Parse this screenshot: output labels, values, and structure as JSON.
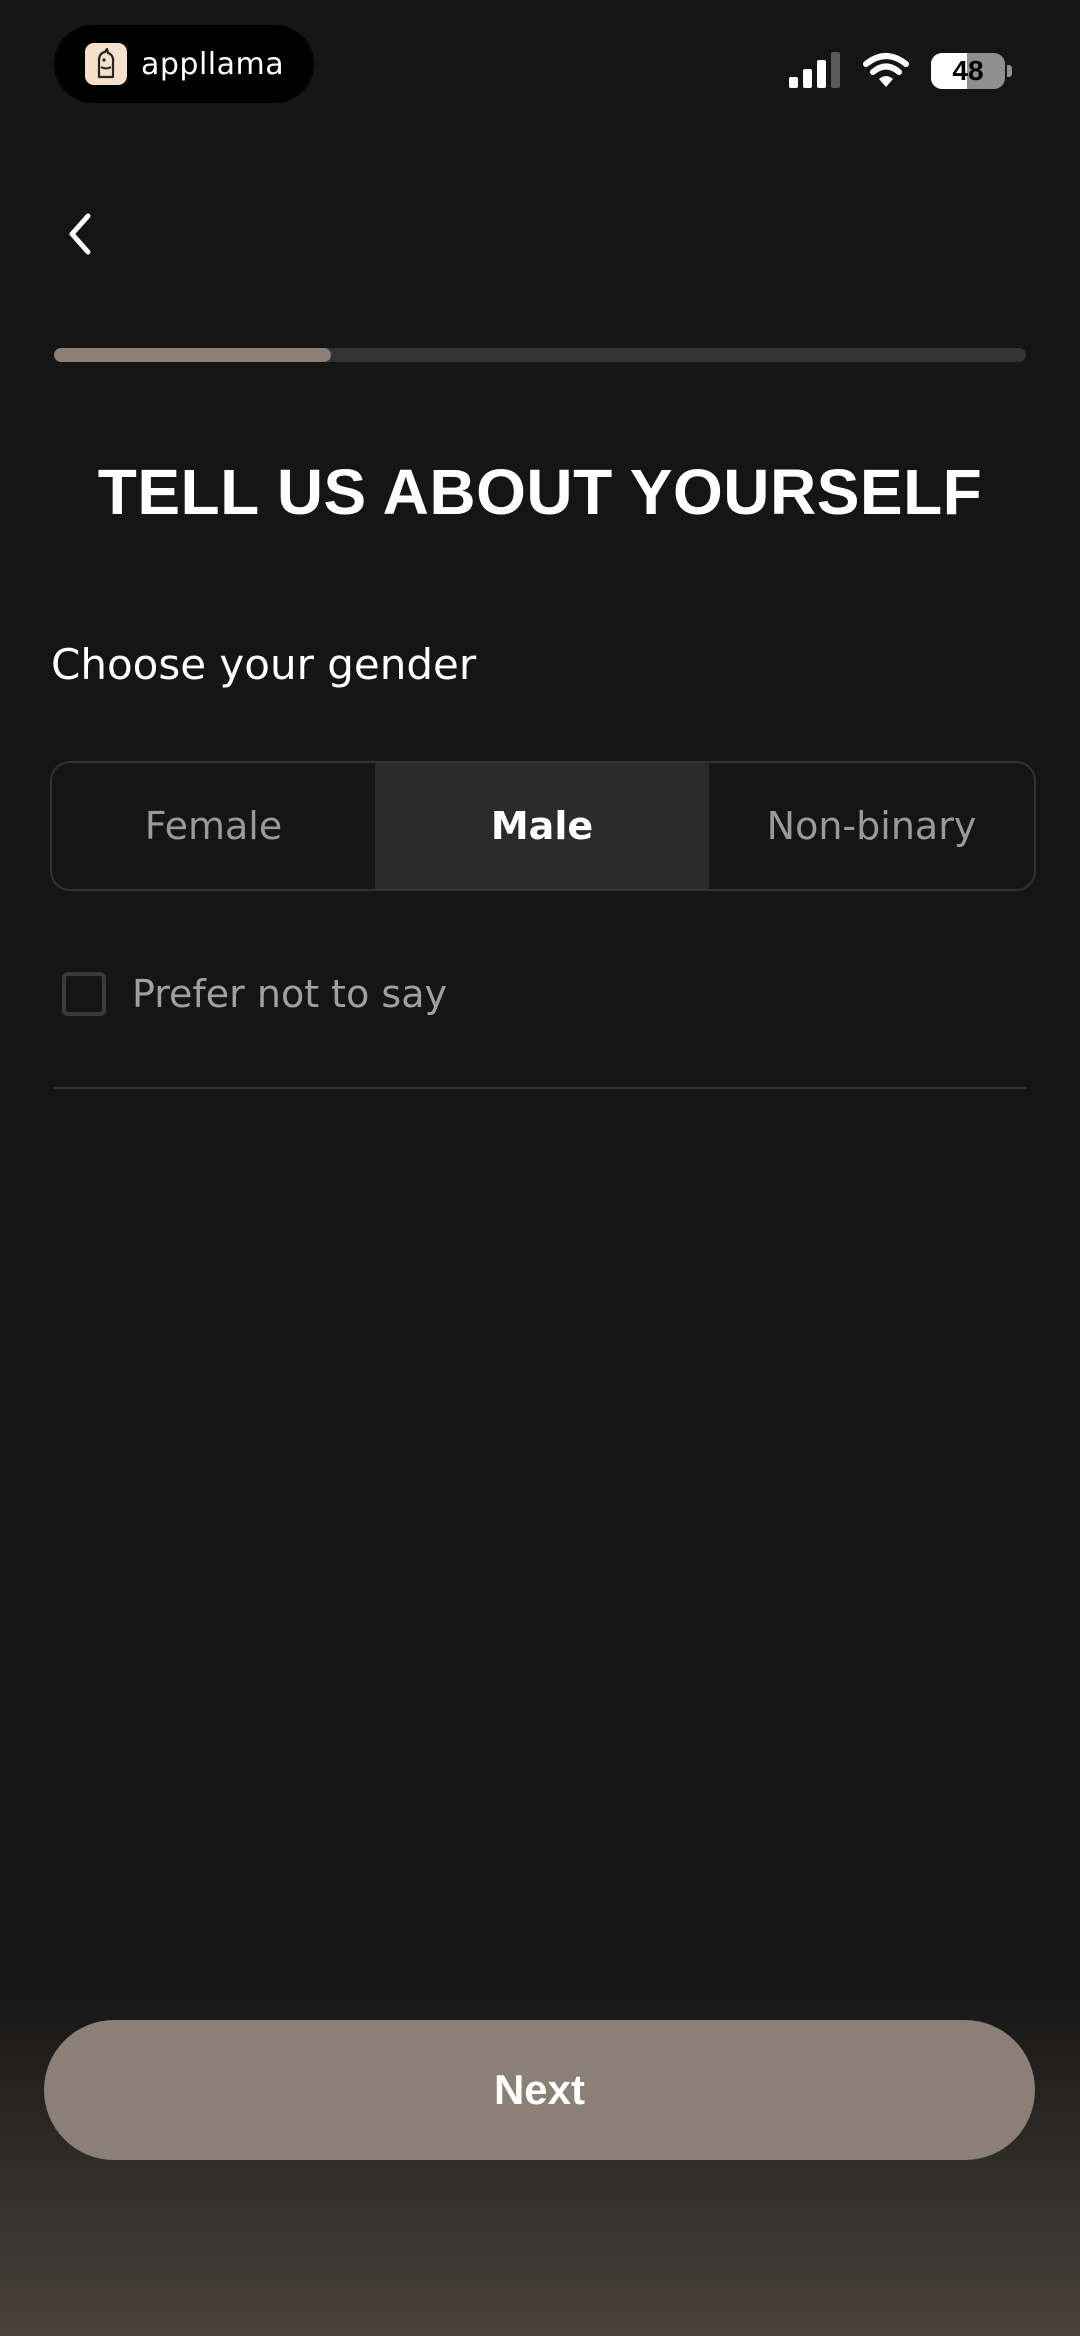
{
  "status_bar": {
    "app_name": "appllama",
    "battery_level": "48",
    "battery_fraction": 0.48
  },
  "navigation": {
    "back_icon": "chevron-left-icon"
  },
  "progress": {
    "fraction": 0.285
  },
  "page": {
    "title": "TELL US ABOUT YOURSELF"
  },
  "gender": {
    "label": "Choose your gender",
    "options": [
      {
        "label": "Female",
        "selected": false
      },
      {
        "label": "Male",
        "selected": true
      },
      {
        "label": "Non-binary",
        "selected": false
      }
    ],
    "prefer_not_to_say": {
      "label": "Prefer not to say",
      "checked": false
    }
  },
  "footer": {
    "next_label": "Next"
  },
  "colors": {
    "background": "#151515",
    "accent": "#8a8075",
    "selected_segment": "#2b2b2b",
    "muted_text": "#9a9a9a"
  }
}
